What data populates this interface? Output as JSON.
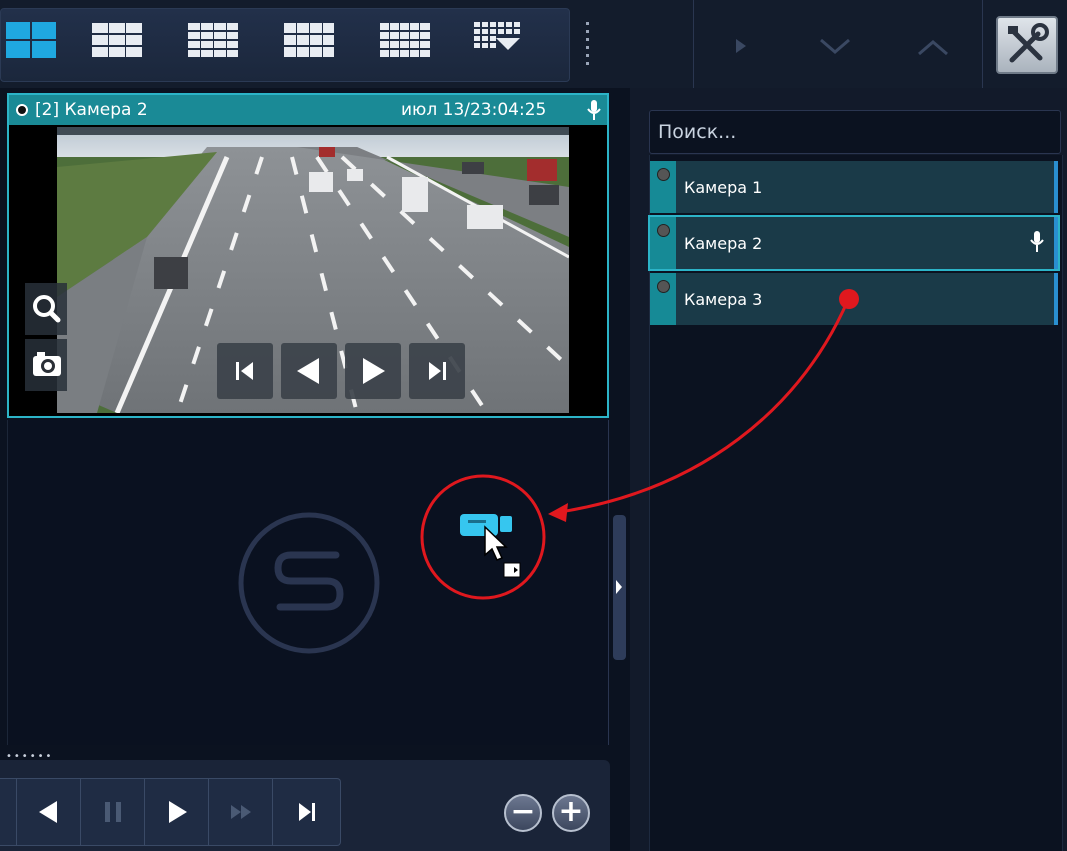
{
  "toolbar": {
    "layouts": [
      {
        "name": "layout-1x2",
        "active": true
      },
      {
        "name": "layout-2x3"
      },
      {
        "name": "layout-3x4"
      },
      {
        "name": "layout-3x4b"
      },
      {
        "name": "layout-4x4"
      },
      {
        "name": "layout-more",
        "icon": "dropdown-grid-icon"
      }
    ],
    "nav_icons": [
      "play-right-icon",
      "chevron-down-icon",
      "chevron-up-icon"
    ],
    "tools_icon": "tools-icon"
  },
  "camera_view": {
    "title": "[2] Камера 2",
    "timestamp": "июл 13/23:04:25",
    "mic_icon": "microphone-icon",
    "side_icons": [
      "zoom-icon",
      "snapshot-icon"
    ],
    "playback_icons": [
      "skip-start-icon",
      "play-back-icon",
      "play-forward-icon",
      "skip-end-icon"
    ]
  },
  "empty_tile": {
    "logo_icon": "s-logo-icon",
    "drag_icon": "camera-drag-icon"
  },
  "bottom_bar": {
    "controls": [
      "skip-start-icon",
      "play-back-icon",
      "pause-icon",
      "fast-forward-icon",
      "play-forward-icon",
      "skip-end-icon"
    ],
    "zoom_out": "−",
    "zoom_in": "+"
  },
  "right_panel": {
    "search_placeholder": "Поиск...",
    "cameras": [
      {
        "label": "Камера 1",
        "selected": false,
        "mic": false
      },
      {
        "label": "Камера 2",
        "selected": true,
        "mic": true
      },
      {
        "label": "Камера 3",
        "selected": false,
        "mic": false
      }
    ]
  },
  "colors": {
    "accent": "#2cb4c8",
    "header": "#1a8a96",
    "drag_arrow": "#e0181e"
  }
}
